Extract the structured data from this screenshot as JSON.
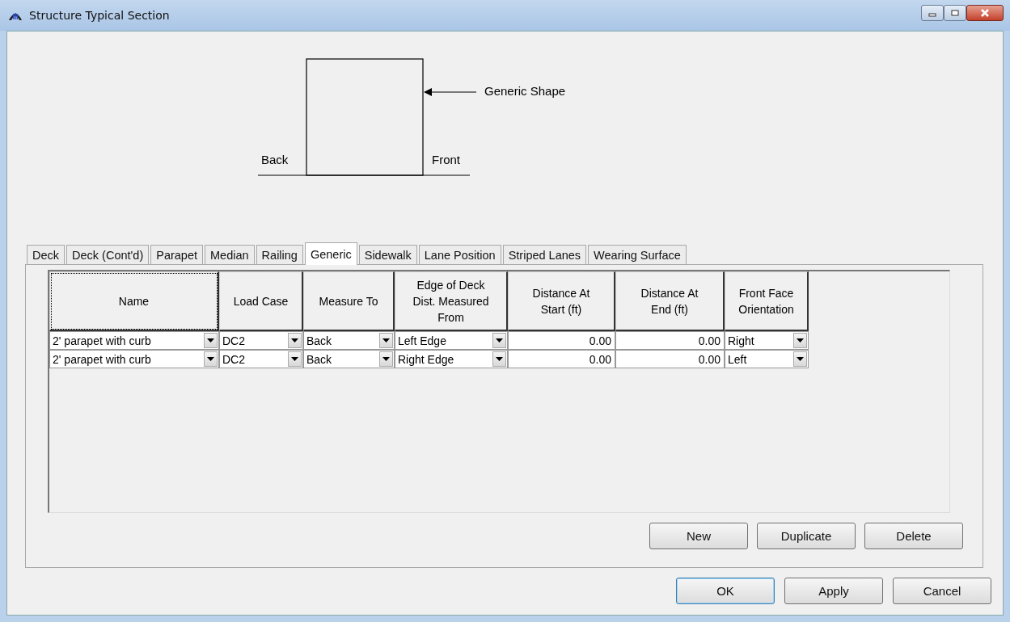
{
  "window": {
    "title": "Structure Typical Section"
  },
  "diagram": {
    "shape_label": "Generic Shape",
    "back_label": "Back",
    "front_label": "Front"
  },
  "tabs": [
    {
      "label": "Deck",
      "selected": false
    },
    {
      "label": "Deck (Cont'd)",
      "selected": false
    },
    {
      "label": "Parapet",
      "selected": false
    },
    {
      "label": "Median",
      "selected": false
    },
    {
      "label": "Railing",
      "selected": false
    },
    {
      "label": "Generic",
      "selected": true
    },
    {
      "label": "Sidewalk",
      "selected": false
    },
    {
      "label": "Lane Position",
      "selected": false
    },
    {
      "label": "Striped Lanes",
      "selected": false
    },
    {
      "label": "Wearing Surface",
      "selected": false
    }
  ],
  "table": {
    "columns": [
      {
        "label": "Name",
        "focused": true,
        "kind": "dropdown"
      },
      {
        "label": "Load Case",
        "focused": false,
        "kind": "dropdown"
      },
      {
        "label": "Measure To",
        "focused": false,
        "kind": "dropdown"
      },
      {
        "label": "Edge of Deck Dist. Measured From",
        "focused": false,
        "kind": "dropdown"
      },
      {
        "label": "Distance At Start (ft)",
        "focused": false,
        "kind": "number"
      },
      {
        "label": "Distance At End (ft)",
        "focused": false,
        "kind": "number"
      },
      {
        "label": "Front Face Orientation",
        "focused": false,
        "kind": "dropdown"
      }
    ],
    "rows": [
      [
        "2' parapet with curb",
        "DC2",
        "Back",
        "Left Edge",
        "0.00",
        "0.00",
        "Right"
      ],
      [
        "2' parapet with curb",
        "DC2",
        "Back",
        "Right Edge",
        "0.00",
        "0.00",
        "Left"
      ]
    ]
  },
  "panel_buttons": [
    "New",
    "Duplicate",
    "Delete"
  ],
  "dialog_buttons": [
    {
      "label": "OK",
      "default": true
    },
    {
      "label": "Apply",
      "default": false
    },
    {
      "label": "Cancel",
      "default": false
    }
  ]
}
